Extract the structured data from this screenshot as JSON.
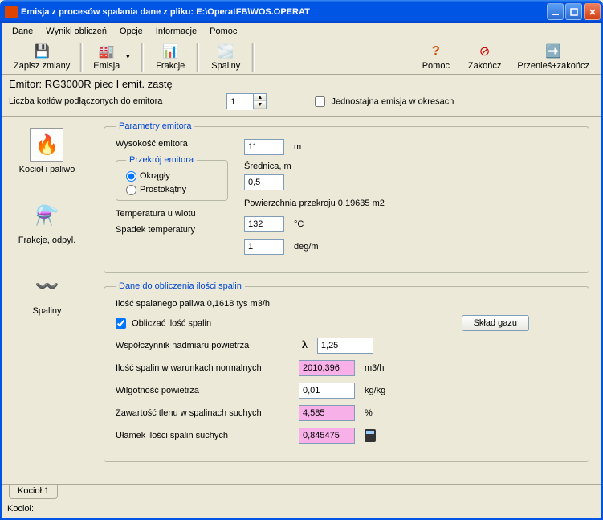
{
  "title": "Emisja z procesów spalania   dane z pliku:  E:\\OperatFB\\WOS.OPERAT",
  "menu": {
    "dane": "Dane",
    "wyniki": "Wyniki obliczeń",
    "opcje": "Opcje",
    "informacje": "Informacje",
    "pomoc": "Pomoc"
  },
  "toolbar": {
    "zapisz": "Zapisz zmiany",
    "emisja": "Emisja",
    "frakcje": "Frakcje",
    "spaliny": "Spaliny",
    "pomoc": "Pomoc",
    "zakoncz": "Zakończ",
    "przenies": "Przenieś+zakończ"
  },
  "emitor_line": "Emitor: RG3000R piec I emit. zastę",
  "kotly_label": "Liczba kotłów podłączonych do emitora",
  "kotly_value": "1",
  "jednostajna": "Jednostajna emisja w okresach",
  "sidebar": {
    "kociol": "Kocioł i  paliwo",
    "frakcje": "Frakcje, odpyl.",
    "spaliny": "Spaliny"
  },
  "params": {
    "legend": "Parametry emitora",
    "wysokosc_label": "Wysokość emitora",
    "wysokosc": "11",
    "wysokosc_unit": "m",
    "przekroj_legend": "Przekrój emitora",
    "okragly": "Okrągły",
    "prostokatny": "Prostokątny",
    "srednica_label": "Średnica, m",
    "srednica": "0,5",
    "powierzchnia": "Powierzchnia przekroju 0,19635 m2",
    "temp_wlotu_label": "Temperatura u wlotu",
    "temp_wlotu": "132",
    "temp_unit": "°C",
    "spadek_label": "Spadek temperatury",
    "spadek": "1",
    "spadek_unit": "deg/m"
  },
  "spaliny": {
    "legend": "Dane do obliczenia ilości spalin",
    "ilosc_paliwa": "Ilość spalanego paliwa   0,1618  tys m3/h",
    "sklad_btn": "Skład gazu",
    "obliczac": "Obliczać ilość spalin",
    "wsp_label": "Współczynnik nadmiaru powietrza",
    "wsp": "1,25",
    "ilosc_norm_label": "Ilość spalin w warunkach normalnych",
    "ilosc_norm": "2010,396",
    "ilosc_norm_unit": "m3/h",
    "wilg_label": "Wilgotność powietrza",
    "wilg": "0,01",
    "wilg_unit": "kg/kg",
    "tlen_label": "Zawartość tlenu w spalinach suchych",
    "tlen": "4,585",
    "tlen_unit": "%",
    "ulamek_label": "Ułamek ilości spalin suchych",
    "ulamek": "0,845475"
  },
  "bottom_tab": "Kocioł 1",
  "status": "Kocioł:"
}
